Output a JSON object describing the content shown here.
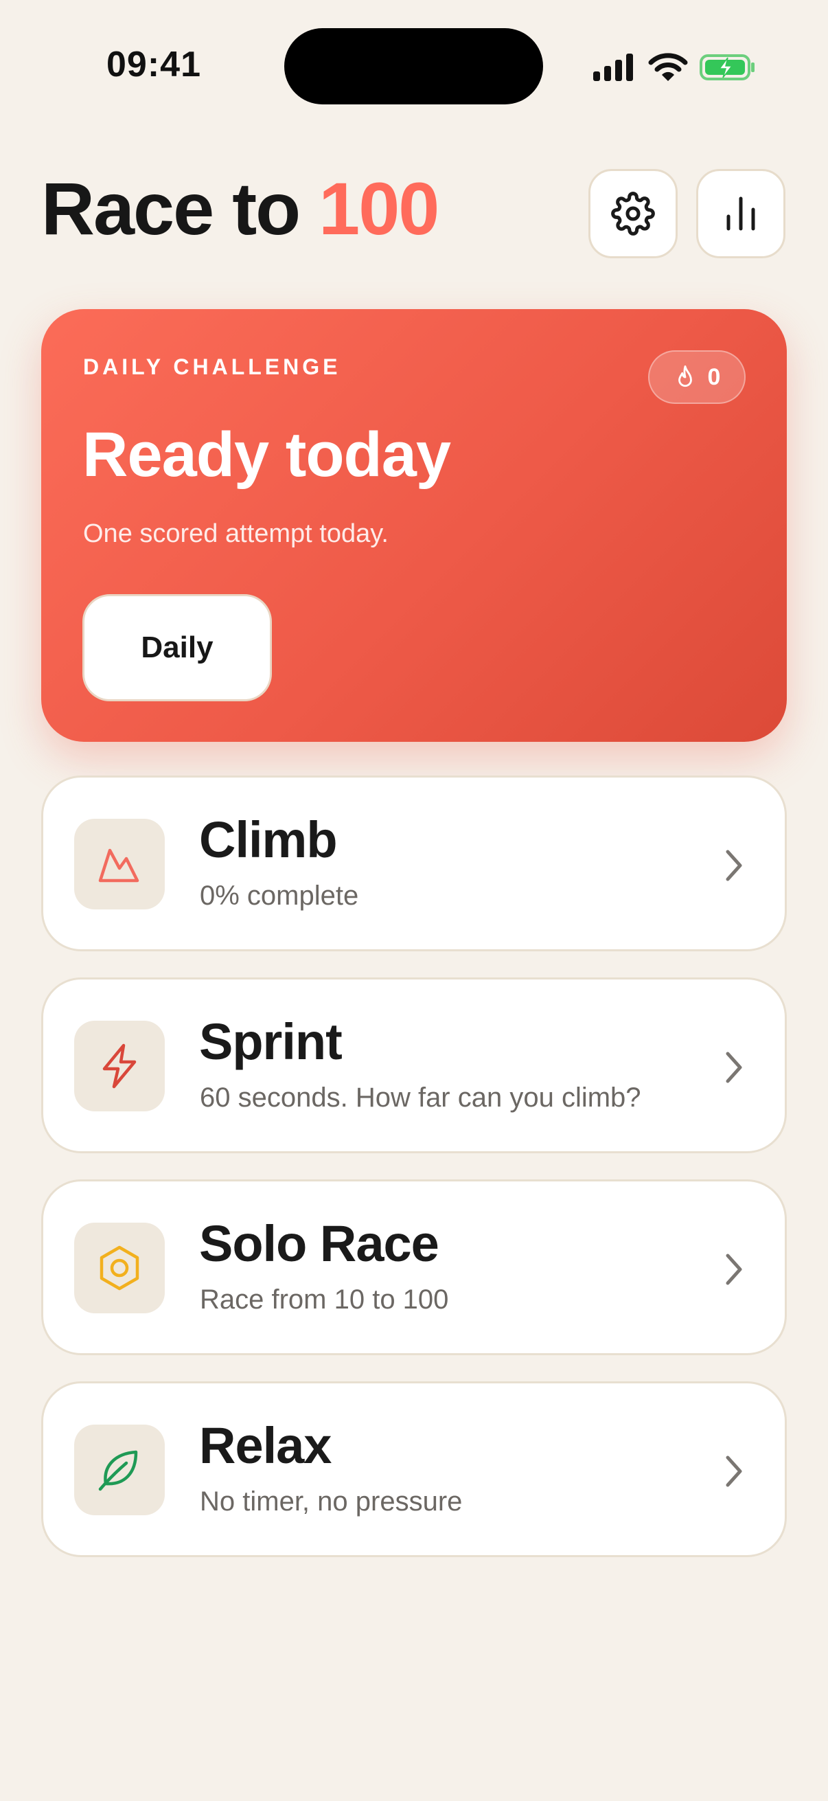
{
  "status_bar": {
    "time": "09:41"
  },
  "header": {
    "title_main": "Race to ",
    "title_accent": "100"
  },
  "daily": {
    "label": "DAILY CHALLENGE",
    "streak_count": "0",
    "title": "Ready today",
    "subtitle": "One scored attempt today.",
    "button_label": "Daily"
  },
  "modes": [
    {
      "title": "Climb",
      "subtitle": "0% complete",
      "icon": "mountain-icon"
    },
    {
      "title": "Sprint",
      "subtitle": "60 seconds. How far can you climb?",
      "icon": "lightning-icon"
    },
    {
      "title": "Solo Race",
      "subtitle": "Race from 10 to 100",
      "icon": "hexagon-icon"
    },
    {
      "title": "Relax",
      "subtitle": "No timer, no pressure",
      "icon": "leaf-icon"
    }
  ],
  "icons": {
    "settings": "gear-icon",
    "stats": "bar-chart-icon",
    "streak": "flame-icon",
    "chevron": "chevron-right-icon"
  },
  "colors": {
    "accent": "#ff6b5b",
    "background": "#f6f1ea",
    "card_gradient_start": "#fb6c58",
    "card_gradient_end": "#dc4a38",
    "climb_icon": "#f26b5e",
    "sprint_icon": "#d9473a",
    "solo_icon": "#f2b01e",
    "relax_icon": "#1f9a55"
  }
}
